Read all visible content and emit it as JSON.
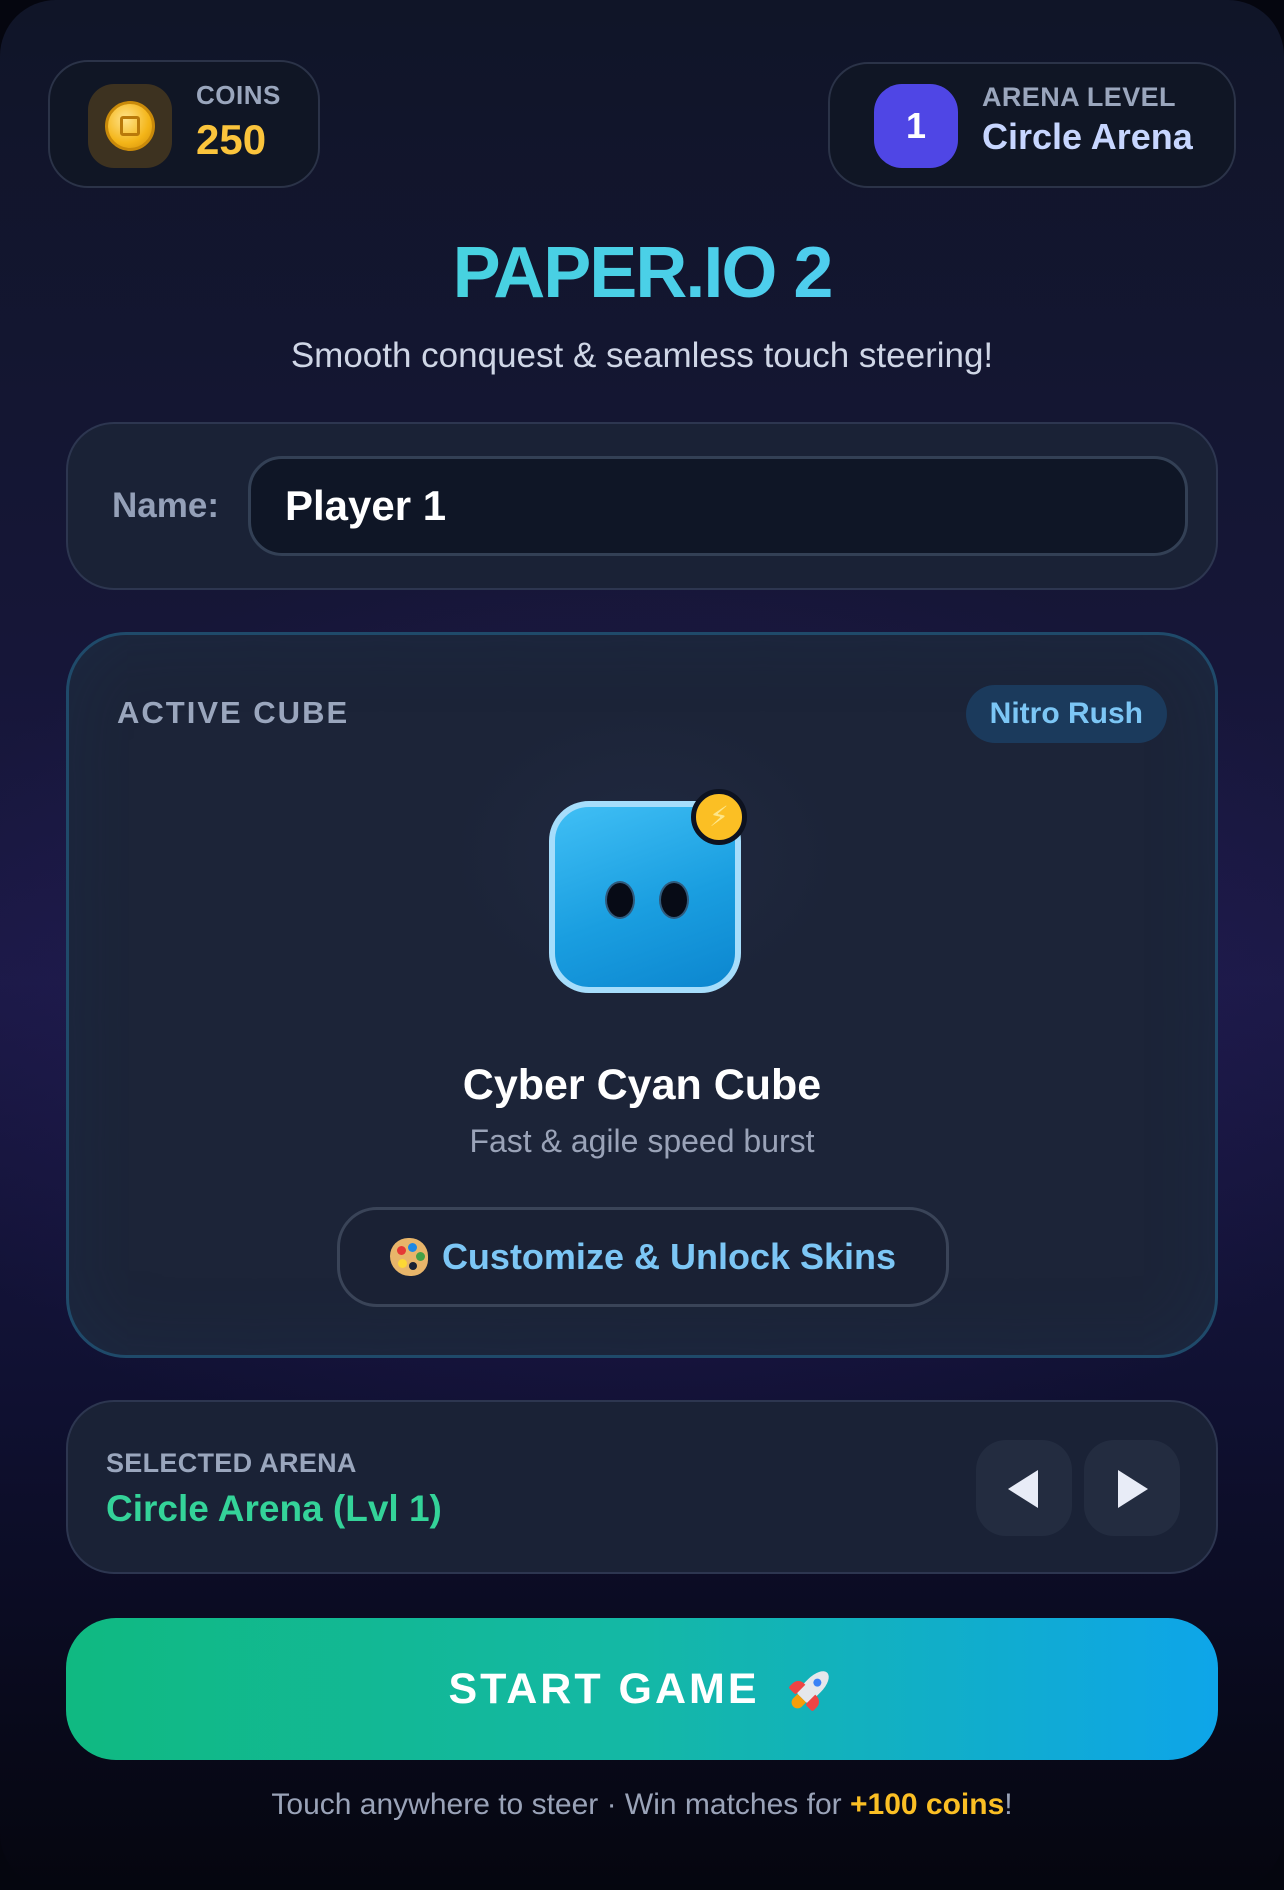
{
  "header": {
    "coins_label": "COINS",
    "coins_value": "250",
    "arena_level_label": "ARENA LEVEL",
    "arena_level_number": "1",
    "arena_name": "Circle Arena"
  },
  "title": "PAPER.IO 2",
  "subtitle": "Smooth conquest & seamless touch steering!",
  "name_field": {
    "label": "Name:",
    "value": "Player 1"
  },
  "active_cube": {
    "section_label": "ACTIVE CUBE",
    "ability_badge": "Nitro Rush",
    "name": "Cyber Cyan Cube",
    "description": "Fast & agile speed burst",
    "customize_label": "Customize & Unlock Skins",
    "colors": {
      "cube": "#1ea2e4",
      "cube_border": "#a6ddfb",
      "badge": "#fbbf24"
    }
  },
  "arena_selector": {
    "label": "SELECTED ARENA",
    "value": "Circle Arena (Lvl 1)"
  },
  "start_button": {
    "label": "START GAME"
  },
  "footer": {
    "text_before": "Touch anywhere to steer · Win matches for ",
    "reward": "+100 coins",
    "text_after": "!"
  },
  "icons": {
    "coin": "coin-icon",
    "bolt": "bolt-icon",
    "palette": "palette-icon",
    "prev": "triangle-left-icon",
    "next": "triangle-right-icon",
    "rocket": "rocket-icon"
  },
  "theme": {
    "accent_teal": "#3fd7cf",
    "accent_green": "#34d399",
    "accent_gold": "#fbc43c",
    "accent_indigo": "#4f46e5",
    "start_gradient_from": "#10b981",
    "start_gradient_to": "#0ea5e9"
  }
}
